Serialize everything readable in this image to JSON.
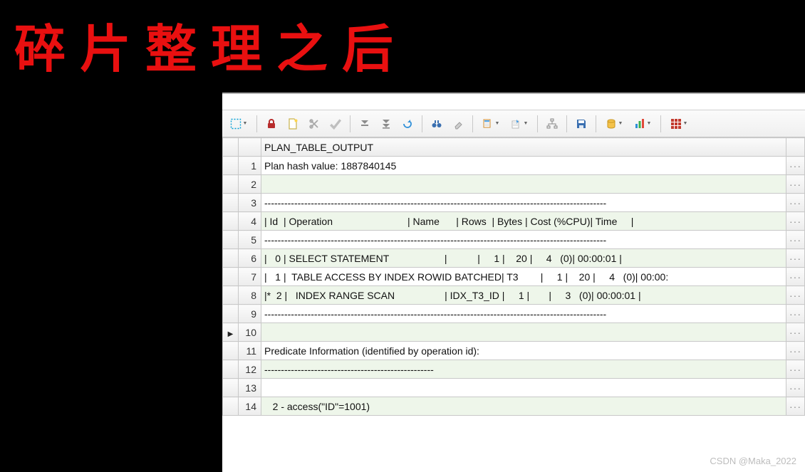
{
  "handwriting_text": "碎片整理之后",
  "top_hint": "",
  "toolbar": {
    "select_region": "",
    "lock": "",
    "new": "",
    "delete": "",
    "commit": "",
    "first": "",
    "last": "",
    "refresh": "",
    "find": "",
    "clear": "",
    "copy": "",
    "tree": "",
    "save": "",
    "db": "",
    "chart": "",
    "grid_view": ""
  },
  "grid": {
    "header": "PLAN_TABLE_OUTPUT",
    "rows": [
      {
        "num": "1",
        "text": "Plan hash value: 1887840145",
        "even": false
      },
      {
        "num": "2",
        "text": "",
        "even": true
      },
      {
        "num": "3",
        "text": "-------------------------------------------------------------------------------------------------------",
        "even": false
      },
      {
        "num": "4",
        "text": "| Id  | Operation                           | Name      | Rows  | Bytes | Cost (%CPU)| Time     |",
        "even": true
      },
      {
        "num": "5",
        "text": "-------------------------------------------------------------------------------------------------------",
        "even": false
      },
      {
        "num": "6",
        "text": "|   0 | SELECT STATEMENT                    |           |     1 |    20 |     4   (0)| 00:00:01 |",
        "even": true
      },
      {
        "num": "7",
        "text": "|   1 |  TABLE ACCESS BY INDEX ROWID BATCHED| T3        |     1 |    20 |     4   (0)| 00:00:",
        "even": false
      },
      {
        "num": "8",
        "text": "|*  2 |   INDEX RANGE SCAN                  | IDX_T3_ID |     1 |       |     3   (0)| 00:00:01 |",
        "even": true
      },
      {
        "num": "9",
        "text": "-------------------------------------------------------------------------------------------------------",
        "even": false
      },
      {
        "num": "10",
        "text": "",
        "even": true,
        "cursor": true
      },
      {
        "num": "11",
        "text": "Predicate Information (identified by operation id):",
        "even": false
      },
      {
        "num": "12",
        "text": "---------------------------------------------------",
        "even": true
      },
      {
        "num": "13",
        "text": "",
        "even": false
      },
      {
        "num": "14",
        "text": "   2 - access(\"ID\"=1001)",
        "even": true
      }
    ],
    "more_marker": "···"
  },
  "watermark": "CSDN @Maka_2022",
  "colors": {
    "accent_red": "#e91010",
    "row_even": "#eef6ea"
  }
}
